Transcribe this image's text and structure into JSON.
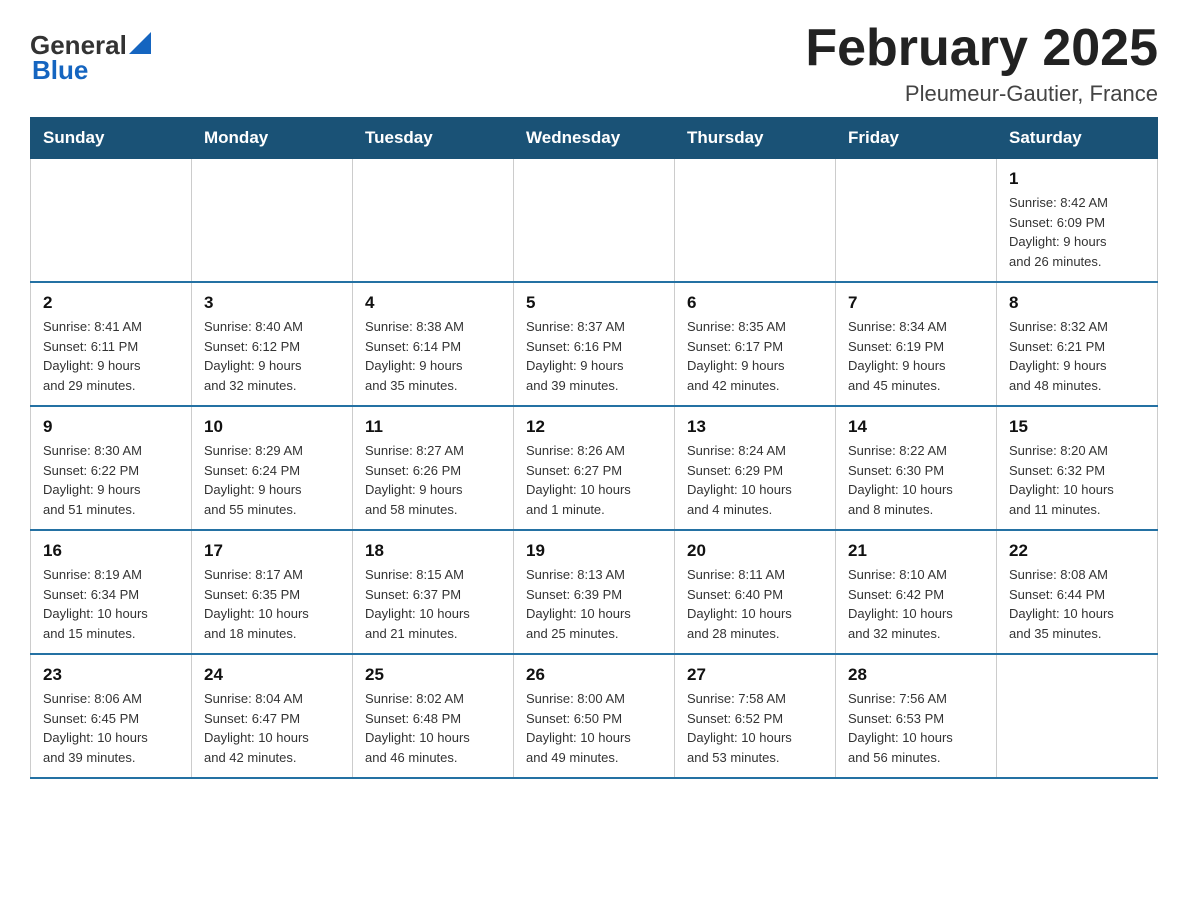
{
  "logo": {
    "general": "General",
    "blue": "Blue"
  },
  "title": "February 2025",
  "subtitle": "Pleumeur-Gautier, France",
  "weekdays": [
    "Sunday",
    "Monday",
    "Tuesday",
    "Wednesday",
    "Thursday",
    "Friday",
    "Saturday"
  ],
  "weeks": [
    [
      {
        "day": "",
        "info": ""
      },
      {
        "day": "",
        "info": ""
      },
      {
        "day": "",
        "info": ""
      },
      {
        "day": "",
        "info": ""
      },
      {
        "day": "",
        "info": ""
      },
      {
        "day": "",
        "info": ""
      },
      {
        "day": "1",
        "info": "Sunrise: 8:42 AM\nSunset: 6:09 PM\nDaylight: 9 hours\nand 26 minutes."
      }
    ],
    [
      {
        "day": "2",
        "info": "Sunrise: 8:41 AM\nSunset: 6:11 PM\nDaylight: 9 hours\nand 29 minutes."
      },
      {
        "day": "3",
        "info": "Sunrise: 8:40 AM\nSunset: 6:12 PM\nDaylight: 9 hours\nand 32 minutes."
      },
      {
        "day": "4",
        "info": "Sunrise: 8:38 AM\nSunset: 6:14 PM\nDaylight: 9 hours\nand 35 minutes."
      },
      {
        "day": "5",
        "info": "Sunrise: 8:37 AM\nSunset: 6:16 PM\nDaylight: 9 hours\nand 39 minutes."
      },
      {
        "day": "6",
        "info": "Sunrise: 8:35 AM\nSunset: 6:17 PM\nDaylight: 9 hours\nand 42 minutes."
      },
      {
        "day": "7",
        "info": "Sunrise: 8:34 AM\nSunset: 6:19 PM\nDaylight: 9 hours\nand 45 minutes."
      },
      {
        "day": "8",
        "info": "Sunrise: 8:32 AM\nSunset: 6:21 PM\nDaylight: 9 hours\nand 48 minutes."
      }
    ],
    [
      {
        "day": "9",
        "info": "Sunrise: 8:30 AM\nSunset: 6:22 PM\nDaylight: 9 hours\nand 51 minutes."
      },
      {
        "day": "10",
        "info": "Sunrise: 8:29 AM\nSunset: 6:24 PM\nDaylight: 9 hours\nand 55 minutes."
      },
      {
        "day": "11",
        "info": "Sunrise: 8:27 AM\nSunset: 6:26 PM\nDaylight: 9 hours\nand 58 minutes."
      },
      {
        "day": "12",
        "info": "Sunrise: 8:26 AM\nSunset: 6:27 PM\nDaylight: 10 hours\nand 1 minute."
      },
      {
        "day": "13",
        "info": "Sunrise: 8:24 AM\nSunset: 6:29 PM\nDaylight: 10 hours\nand 4 minutes."
      },
      {
        "day": "14",
        "info": "Sunrise: 8:22 AM\nSunset: 6:30 PM\nDaylight: 10 hours\nand 8 minutes."
      },
      {
        "day": "15",
        "info": "Sunrise: 8:20 AM\nSunset: 6:32 PM\nDaylight: 10 hours\nand 11 minutes."
      }
    ],
    [
      {
        "day": "16",
        "info": "Sunrise: 8:19 AM\nSunset: 6:34 PM\nDaylight: 10 hours\nand 15 minutes."
      },
      {
        "day": "17",
        "info": "Sunrise: 8:17 AM\nSunset: 6:35 PM\nDaylight: 10 hours\nand 18 minutes."
      },
      {
        "day": "18",
        "info": "Sunrise: 8:15 AM\nSunset: 6:37 PM\nDaylight: 10 hours\nand 21 minutes."
      },
      {
        "day": "19",
        "info": "Sunrise: 8:13 AM\nSunset: 6:39 PM\nDaylight: 10 hours\nand 25 minutes."
      },
      {
        "day": "20",
        "info": "Sunrise: 8:11 AM\nSunset: 6:40 PM\nDaylight: 10 hours\nand 28 minutes."
      },
      {
        "day": "21",
        "info": "Sunrise: 8:10 AM\nSunset: 6:42 PM\nDaylight: 10 hours\nand 32 minutes."
      },
      {
        "day": "22",
        "info": "Sunrise: 8:08 AM\nSunset: 6:44 PM\nDaylight: 10 hours\nand 35 minutes."
      }
    ],
    [
      {
        "day": "23",
        "info": "Sunrise: 8:06 AM\nSunset: 6:45 PM\nDaylight: 10 hours\nand 39 minutes."
      },
      {
        "day": "24",
        "info": "Sunrise: 8:04 AM\nSunset: 6:47 PM\nDaylight: 10 hours\nand 42 minutes."
      },
      {
        "day": "25",
        "info": "Sunrise: 8:02 AM\nSunset: 6:48 PM\nDaylight: 10 hours\nand 46 minutes."
      },
      {
        "day": "26",
        "info": "Sunrise: 8:00 AM\nSunset: 6:50 PM\nDaylight: 10 hours\nand 49 minutes."
      },
      {
        "day": "27",
        "info": "Sunrise: 7:58 AM\nSunset: 6:52 PM\nDaylight: 10 hours\nand 53 minutes."
      },
      {
        "day": "28",
        "info": "Sunrise: 7:56 AM\nSunset: 6:53 PM\nDaylight: 10 hours\nand 56 minutes."
      },
      {
        "day": "",
        "info": ""
      }
    ]
  ]
}
